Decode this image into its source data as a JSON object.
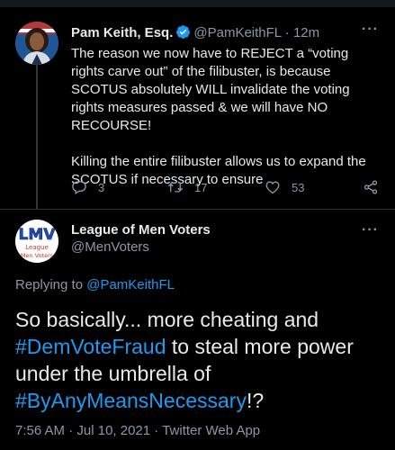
{
  "parent_tweet": {
    "name": "Pam Keith, Esq.",
    "handle": "@PamKeithFL",
    "separator": "·",
    "time": "12m",
    "text_p1": "The reason we now have to REJECT a “voting rights carve out” of the filibuster, is because SCOTUS absolutely WILL invalidate the voting rights measures passed & we will have NO RECOURSE!",
    "text_p2": "Killing the entire filibuster allows us to expand the SCOTUS if necessary to ensure",
    "replies": "3",
    "retweets": "17",
    "likes": "53",
    "icons": [
      "verified-badge-icon",
      "reply-icon",
      "retweet-icon",
      "like-icon",
      "share-icon",
      "more-icon"
    ]
  },
  "main_tweet": {
    "name": "League of Men Voters",
    "handle": "@MenVoters",
    "avatar": {
      "logo_text": "LMV",
      "line1": "League",
      "line2": "Men Voters"
    },
    "replying_label": "Replying to",
    "replying_handle": "@PamKeithFL",
    "text_a": "So basically... more cheating and",
    "hashtag1": "#DemVoteFraud",
    "text_b": "to steal more power under the umbrella of",
    "hashtag2": "#ByAnyMeansNecessary",
    "text_c": "!?",
    "time": "7:56 AM",
    "date": "Jul 10, 2021",
    "source": "Twitter Web App",
    "meta_sep": "·"
  },
  "colors": {
    "background": "#000000",
    "text": "#e7e9ea",
    "muted": "#8b98a5",
    "link": "#1d9bf0",
    "divider": "#2f3336",
    "verified": "#1d9bf0",
    "lmv_blue": "#1f4fb5"
  }
}
